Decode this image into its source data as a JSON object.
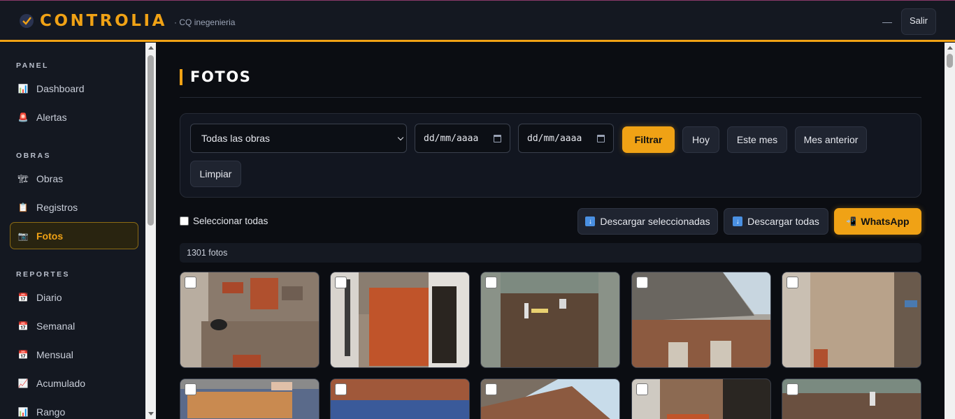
{
  "app": {
    "brand_name": "CONTROLIA",
    "brand_sub": "· CQ inegenieria",
    "minimize_label": "—",
    "logout_label": "Salir"
  },
  "sidebar": {
    "sections": [
      {
        "title": "PANEL"
      },
      {
        "title": "OBRAS"
      },
      {
        "title": "REPORTES"
      }
    ],
    "items": [
      {
        "label": "Dashboard",
        "icon": "bar-chart-icon",
        "glyph": "📊"
      },
      {
        "label": "Alertas",
        "icon": "siren-icon",
        "glyph": "🚨"
      },
      {
        "label": "Obras",
        "icon": "crane-icon",
        "glyph": "🏗"
      },
      {
        "label": "Registros",
        "icon": "clipboard-icon",
        "glyph": "📋"
      },
      {
        "label": "Fotos",
        "icon": "camera-icon",
        "glyph": "📷",
        "active": true
      },
      {
        "label": "Diario",
        "icon": "calendar-icon",
        "glyph": "📅"
      },
      {
        "label": "Semanal",
        "icon": "calendar-icon",
        "glyph": "📅"
      },
      {
        "label": "Mensual",
        "icon": "calendar-icon",
        "glyph": "📅"
      },
      {
        "label": "Acumulado",
        "icon": "trend-chart-icon",
        "glyph": "📈"
      },
      {
        "label": "Rango",
        "icon": "bar-chart-icon",
        "glyph": "📊"
      }
    ]
  },
  "main": {
    "title": "FOTOS",
    "filters": {
      "obra_select": "Todas las obras",
      "date_from_placeholder": "dd/mm/aaaa",
      "date_to_placeholder": "dd/mm/aaaa",
      "filter_button": "Filtrar",
      "today_button": "Hoy",
      "this_month_button": "Este mes",
      "last_month_button": "Mes anterior",
      "clear_button": "Limpiar"
    },
    "actions": {
      "select_all_label": "Seleccionar todas",
      "download_selected": "Descargar seleccionadas",
      "download_all": "Descargar todas",
      "whatsapp": "WhatsApp"
    },
    "photo_count": "1301 fotos"
  },
  "colors": {
    "accent": "#f0a215",
    "background": "#0b0d12",
    "panel": "#141821"
  }
}
